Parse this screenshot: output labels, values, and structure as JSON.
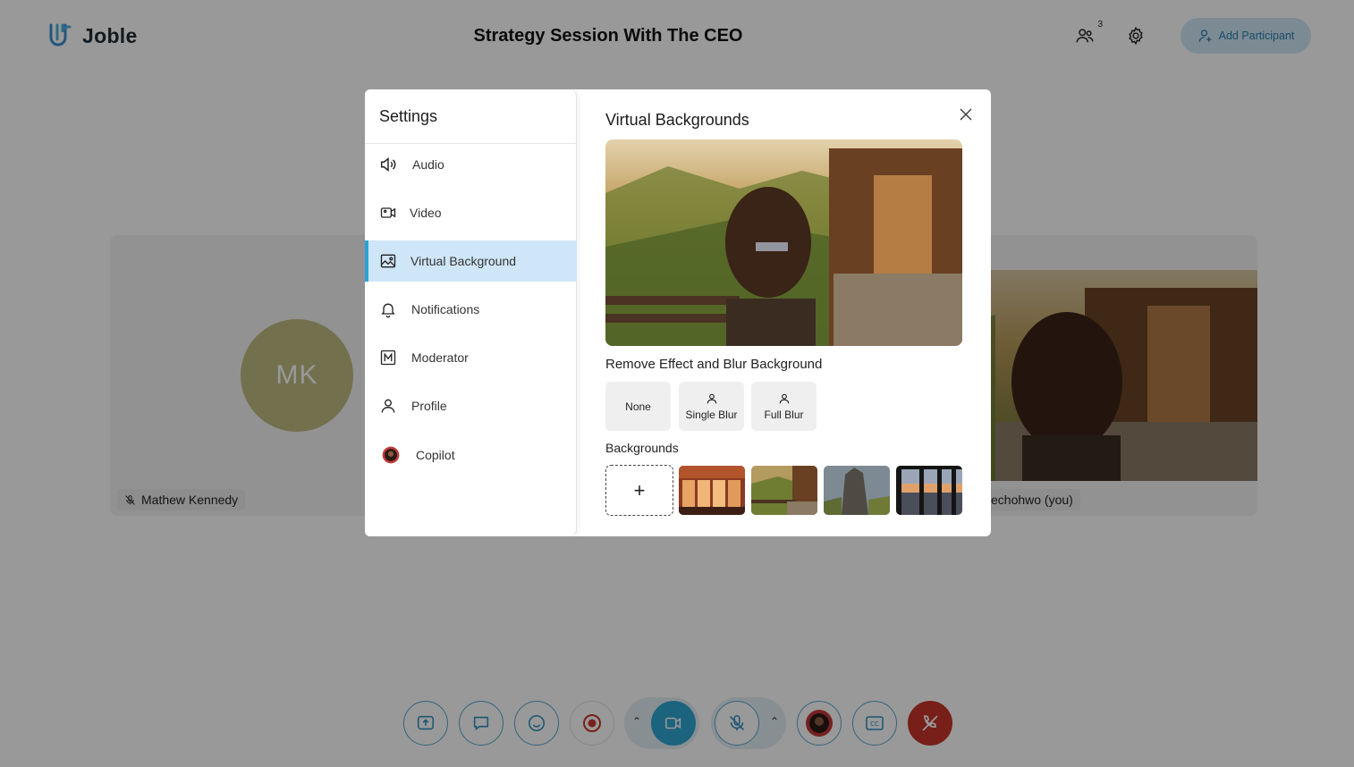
{
  "app": {
    "name": "Joble"
  },
  "header": {
    "meeting_title": "Strategy Session With The CEO",
    "participants_count": "3",
    "add_participant_label": "Add Participant"
  },
  "tiles": {
    "left": {
      "initials": "MK",
      "name": "Mathew Kennedy"
    },
    "right": {
      "name": "echohwo (you)"
    }
  },
  "settings": {
    "title": "Settings",
    "menu": [
      {
        "label": "Audio",
        "icon": "speaker-icon"
      },
      {
        "label": "Video",
        "icon": "video-camera-icon"
      },
      {
        "label": "Virtual Background",
        "icon": "image-icon",
        "active": true
      },
      {
        "label": "Notifications",
        "icon": "bell-icon"
      },
      {
        "label": "Moderator",
        "icon": "moderator-icon"
      },
      {
        "label": "Profile",
        "icon": "user-icon"
      },
      {
        "label": "Copilot",
        "icon": "copilot-avatar-icon"
      }
    ]
  },
  "virtual_backgrounds": {
    "title": "Virtual Backgrounds",
    "effects_label": "Remove Effect and Blur Background",
    "effects": [
      {
        "label": "None"
      },
      {
        "label": "Single Blur"
      },
      {
        "label": "Full Blur"
      }
    ],
    "backgrounds_label": "Backgrounds",
    "add_symbol": "+"
  },
  "colors": {
    "accent": "#29a3d8",
    "active_bg": "#cfe6f8",
    "avatar": "#c0bb83",
    "end_call": "#c9352b"
  }
}
